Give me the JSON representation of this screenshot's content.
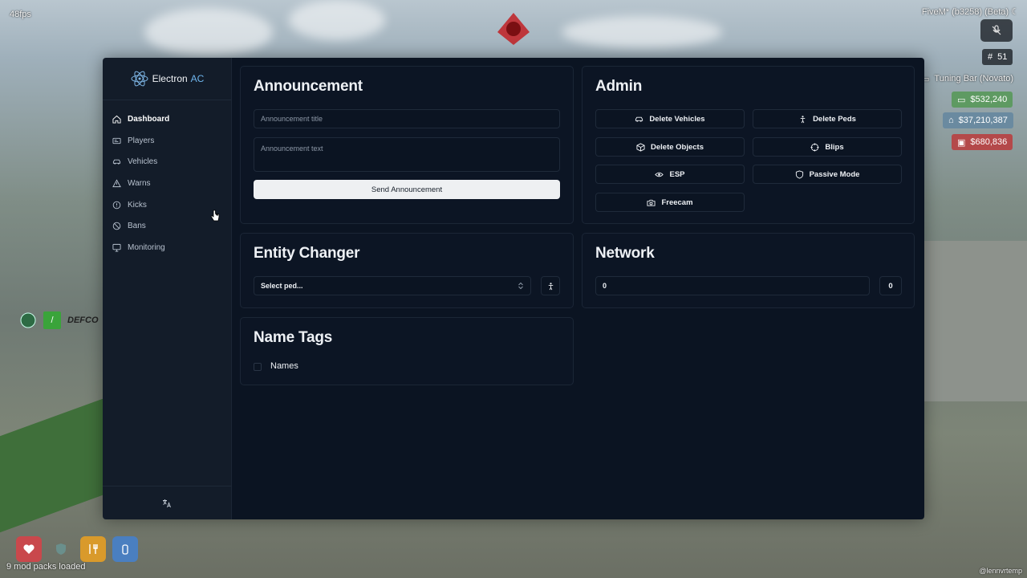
{
  "hud": {
    "fps": "48fps",
    "client": "FiveM* (b3258) (Beta)",
    "players_count": "51",
    "location": "Tuning Bar (Novato)",
    "cash": "$532,240",
    "bank": "$37,210,387",
    "dirty_money": "$680,836",
    "mods_loaded": "9 mod packs loaded",
    "defcon_label": "DEFCO",
    "defcon_level": "/",
    "watermark": "@lennvrtemp"
  },
  "brand": {
    "name": "Electron",
    "accent": "AC"
  },
  "sidebar": {
    "items": [
      {
        "label": "Dashboard",
        "icon": "home-icon",
        "active": true
      },
      {
        "label": "Players",
        "icon": "id-card-icon"
      },
      {
        "label": "Vehicles",
        "icon": "car-icon"
      },
      {
        "label": "Warns",
        "icon": "warning-icon"
      },
      {
        "label": "Kicks",
        "icon": "alert-circle-icon"
      },
      {
        "label": "Bans",
        "icon": "ban-icon"
      },
      {
        "label": "Monitoring",
        "icon": "monitor-icon"
      }
    ],
    "footer_icon": "translate-icon"
  },
  "announcement": {
    "title": "Announcement",
    "title_placeholder": "Announcement title",
    "text_placeholder": "Announcement text",
    "send_label": "Send Announcement"
  },
  "admin": {
    "title": "Admin",
    "buttons": [
      {
        "label": "Delete Vehicles",
        "icon": "car-icon"
      },
      {
        "label": "Delete Peds",
        "icon": "person-icon"
      },
      {
        "label": "Delete Objects",
        "icon": "box-icon"
      },
      {
        "label": "Blips",
        "icon": "crosshair-icon"
      },
      {
        "label": "ESP",
        "icon": "eye-icon"
      },
      {
        "label": "Passive Mode",
        "icon": "shield-icon"
      },
      {
        "label": "Freecam",
        "icon": "camera-icon"
      }
    ]
  },
  "entity_changer": {
    "title": "Entity Changer",
    "select_value": "Select ped..."
  },
  "network": {
    "title": "Network",
    "input_value": "0",
    "button_value": "0"
  },
  "name_tags": {
    "title": "Name Tags",
    "checkbox_label": "Names",
    "checked": false
  },
  "colors": {
    "sidebar_bg": "#131c29",
    "main_bg": "#0b1422",
    "accent": "#6fb6ee",
    "cash": "#5e9a62",
    "bank": "#6a8aa0",
    "dirty": "#b4494a"
  }
}
